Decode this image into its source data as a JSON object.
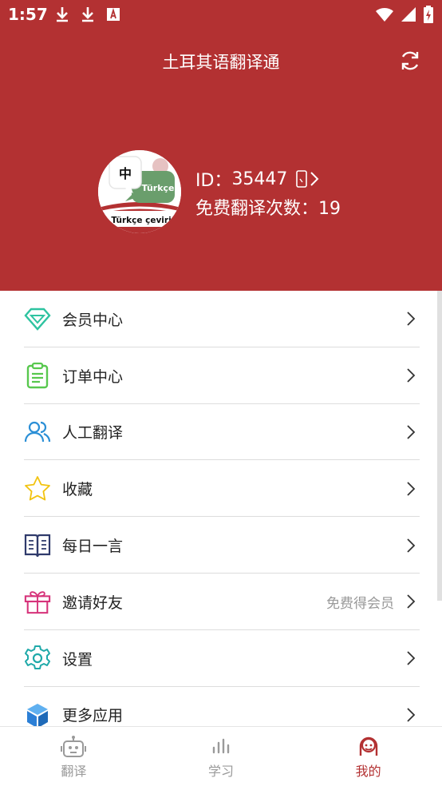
{
  "status": {
    "time": "1:57"
  },
  "header": {
    "title": "土耳其语翻译通",
    "avatar_text_zh": "中",
    "avatar_text_tr": "Türkçe",
    "avatar_caption": "Türkçe çeviri",
    "id_label": "ID：",
    "id_value": "35447",
    "free_label": "免费翻译次数：",
    "free_value": "19"
  },
  "menu": [
    {
      "label": "会员中心",
      "icon": "diamond-icon",
      "right": ""
    },
    {
      "label": "订单中心",
      "icon": "clipboard-icon",
      "right": ""
    },
    {
      "label": "人工翻译",
      "icon": "people-icon",
      "right": ""
    },
    {
      "label": "收藏",
      "icon": "star-icon",
      "right": ""
    },
    {
      "label": "每日一言",
      "icon": "book-icon",
      "right": ""
    },
    {
      "label": "邀请好友",
      "icon": "gift-icon",
      "right": "免费得会员"
    },
    {
      "label": "设置",
      "icon": "gear-icon",
      "right": ""
    },
    {
      "label": "更多应用",
      "icon": "cube-icon",
      "right": ""
    }
  ],
  "tabs": [
    {
      "label": "翻译",
      "icon": "robot-icon",
      "active": false
    },
    {
      "label": "学习",
      "icon": "bar-chart-icon",
      "active": false
    },
    {
      "label": "我的",
      "icon": "profile-face-icon",
      "active": true
    }
  ],
  "colors": {
    "brand": "#b33132",
    "inactive": "#9a9a9a"
  }
}
